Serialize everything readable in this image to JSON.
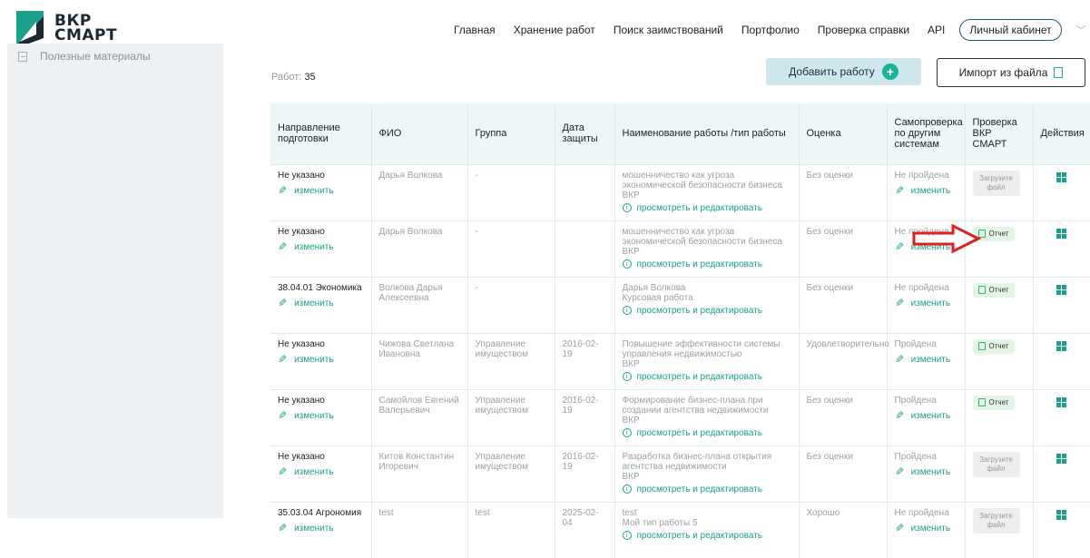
{
  "logo": {
    "line1": "ВКР",
    "line2": "СМАРТ"
  },
  "nav": [
    "Главная",
    "Хранение работ",
    "Поиск заимствований",
    "Портфолио",
    "Проверка справки",
    "API"
  ],
  "cabinet_label": "Личный кабинет",
  "language": "ru",
  "sidebar": {
    "item_label": "Полезные материалы"
  },
  "works_count_label": "Работ:",
  "works_count": "35",
  "add_work_label": "Добавить работу",
  "import_label": "Импорт из файла",
  "table": {
    "headers": [
      "Направление подготовки",
      "ФИО",
      "Группа",
      "Дата защиты",
      "Наименование работы /тип работы",
      "Оценка",
      "Самопроверка по другим системам",
      "Проверка ВКР СМАРТ",
      "Действия"
    ],
    "edit_label": "изменить",
    "view_label": "просмотреть и редактировать",
    "upload_label": "Загрузите файл",
    "report_label": "Отчет",
    "rows": [
      {
        "direction": "Не указано",
        "fio": "Дарья Волкова",
        "group": "-",
        "date": "",
        "title": "мошенничество как угроза экономической безопасности бизнеса",
        "type": "ВКР",
        "grade": "Без оценки",
        "selfcheck": "Не пройдена",
        "check": "upload"
      },
      {
        "direction": "Не указано",
        "fio": "Дарья Волкова",
        "group": "-",
        "date": "",
        "title": "мошенничество как угроза экономической безопасности бизнеса",
        "type": "ВКР",
        "grade": "Без оценки",
        "selfcheck": "Не пройдена",
        "check": "report"
      },
      {
        "direction": "38.04.01 Экономика",
        "fio": "Волкова Дарья Алексеевна",
        "group": "-",
        "date": "",
        "title": "Дарья Волкова",
        "type": "Курсовая работа",
        "grade": "Без оценки",
        "selfcheck": "Не пройдена",
        "check": "report"
      },
      {
        "direction": "Не указано",
        "fio": "Чижова Светлана Ивановна",
        "group": "Управление имуществом",
        "date": "2016-02-19",
        "title": "Повышение эффективности системы управления недвижимостью",
        "type": "ВКР",
        "grade": "Удовлетворительно",
        "selfcheck": "Пройдена",
        "check": "report"
      },
      {
        "direction": "Не указано",
        "fio": "Самойлов Евгений Валерьевич",
        "group": "Управление имуществом",
        "date": "2016-02-19",
        "title": "Формирование бизнес-плана при создании агентства недвижимости",
        "type": "ВКР",
        "grade": "Без оценки",
        "selfcheck": "Пройдена",
        "check": "report"
      },
      {
        "direction": "Не указано",
        "fio": "Китов Константин Игоревич",
        "group": "Управление имуществом",
        "date": "2016-02-19",
        "title": "Разработка бизнес-плана открытия агентства недвижимости",
        "type": "ВКР",
        "grade": "Без оценки",
        "selfcheck": "Пройдена",
        "check": "upload"
      },
      {
        "direction": "35.03.04 Агрономия",
        "fio": "test",
        "group": "test",
        "date": "2025-02-04",
        "title": "test",
        "type": "Мой тип работы 5",
        "grade": "Хорошо",
        "selfcheck": "Не пройдена",
        "check": "upload"
      }
    ]
  },
  "colors": {
    "accent": "#1aa08b",
    "header_bg": "#eef7f8",
    "add_btn": "#cfe7ec",
    "arrow": "#e02020"
  }
}
